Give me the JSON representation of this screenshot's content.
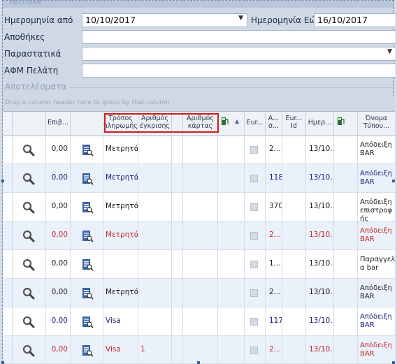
{
  "top_label": "Κριτήρια",
  "filters": {
    "date_from_label": "Ημερομηνία από",
    "date_from_value": "10/10/2017",
    "date_to_label": "Ημερομηνία Εώς",
    "date_to_value": "16/10/2017",
    "warehouses_label": "Αποθήκες",
    "documents_label": "Παραστατικά",
    "afm_label": "ΑΦΜ Πελάτη"
  },
  "results_label": "Αποτελέσματα",
  "group_hint": "Drag a column header here to group by that column",
  "columns": {
    "c1": "Επιβ...",
    "c2": "Τρόπος πληρωμής",
    "c3": "Αριθμός έγκρισης",
    "c4": "Αριθμός κάρτας",
    "c5": "Eur...",
    "c6": "Α... σ...",
    "c7": "Eur... Id",
    "c8": "Ημερ...",
    "c9": "Όνομα Τύπου..."
  },
  "rows": [
    {
      "amount": "0,00",
      "payment": "Μετρητά",
      "approval": "",
      "a": "2...",
      "id": "",
      "date": "13/10...",
      "type": "Απόδειξη BAR",
      "style": "normal"
    },
    {
      "amount": "0,00",
      "payment": "Μετρητά",
      "approval": "",
      "a": "118",
      "id": "",
      "date": "13/10...",
      "type": "Απόδειξη BAR",
      "style": "blue"
    },
    {
      "amount": "0,00",
      "payment": "Μετρητά",
      "approval": "",
      "a": "370",
      "id": "",
      "date": "13/10...",
      "type": "Απόδειξη επιστροφ ής",
      "style": "normal"
    },
    {
      "amount": "0,00",
      "payment": "Μετρητά",
      "approval": "",
      "a": "2...",
      "id": "",
      "date": "13/10...",
      "type": "Απόδειξη BAR",
      "style": "red"
    },
    {
      "amount": "0,00",
      "payment": "",
      "approval": "",
      "a": "1...",
      "id": "",
      "date": "13/10...",
      "type": "Παραγγελί α bar",
      "style": "normal"
    },
    {
      "amount": "0,00",
      "payment": "Μετρητά",
      "approval": "",
      "a": "2...",
      "id": "",
      "date": "13/10...",
      "type": "Απόδειξη BAR",
      "style": "normal"
    },
    {
      "amount": "0,00",
      "payment": "Visa",
      "approval": "",
      "a": "117",
      "id": "",
      "date": "13/10...",
      "type": "Απόδειξη BAR",
      "style": "blue"
    },
    {
      "amount": "0,00",
      "payment": "Visa",
      "approval": "1",
      "a": "2...",
      "id": "",
      "date": "13/10...",
      "type": "Απόδειξη BAR",
      "style": "red"
    }
  ],
  "colors": {
    "red": "#c62828",
    "blue": "#1a237e",
    "highlight": "#d11b1b"
  }
}
